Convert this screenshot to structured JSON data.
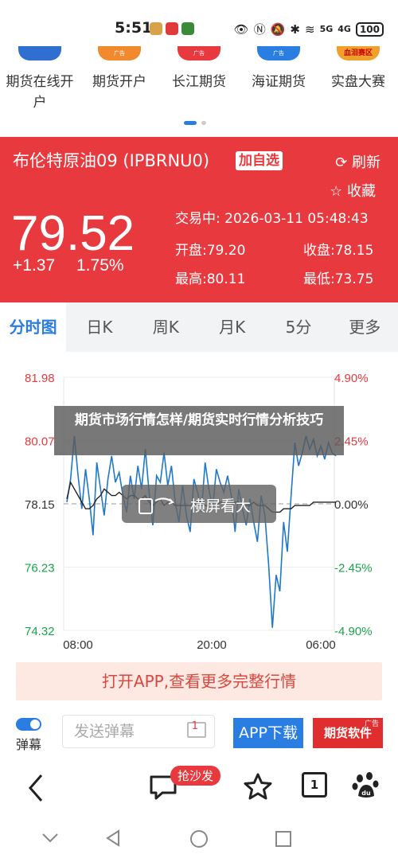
{
  "status_bar": {
    "time": "5:51",
    "network": "5G",
    "network2": "4G",
    "battery": "100"
  },
  "shortcuts": [
    {
      "label": "期货在线开户",
      "color": "#2e6fcf"
    },
    {
      "label": "期货开户",
      "color": "#f08a2c",
      "tag": "广告"
    },
    {
      "label": "长江期货",
      "color": "#e8393e",
      "tag": "广告"
    },
    {
      "label": "海证期货",
      "color": "#2a7de1",
      "tag": "广告"
    },
    {
      "label": "实盘大赛",
      "color": "#f0a12c",
      "tag": "血泪赛区"
    }
  ],
  "quote": {
    "name": "布伦特原油09 (IPBRNU0)",
    "watch_label": "加自选",
    "refresh_label": "刷新",
    "fav_label": "收藏",
    "price": "79.52",
    "change": "+1.37",
    "change_pct": "1.75%",
    "trade_status": "交易中: 2026-03-11 05:48:43",
    "open": "开盘:79.20",
    "prev_close": "收盘:78.15",
    "high": "最高:80.11",
    "low": "最低:73.75"
  },
  "tabs": [
    "分时图",
    "日K",
    "周K",
    "月K",
    "5分",
    "更多"
  ],
  "chart_data": {
    "type": "line",
    "title": "",
    "xlabel": "",
    "ylabel": "",
    "x_ticks": [
      "08:00",
      "20:00",
      "06:00"
    ],
    "y_ticks_left": [
      "81.98",
      "80.07",
      "78.15",
      "76.23",
      "74.32"
    ],
    "y_ticks_right": [
      "4.90%",
      "2.45%",
      "0.00%",
      "-2.45%",
      "-4.90%"
    ],
    "ylim": [
      74.32,
      81.98
    ],
    "reference_price": 78.15,
    "series": [
      {
        "color": "#1f78c8",
        "values": [
          78.2,
          78.9,
          80.2,
          79.0,
          78.0,
          79.2,
          78.3,
          77.2,
          79.4,
          78.6,
          77.8,
          78.9,
          79.6,
          78.8,
          79.1,
          78.4,
          77.9,
          79.0,
          78.3,
          79.3,
          78.6,
          79.8,
          78.5,
          77.5,
          79.0,
          78.8,
          79.7,
          78.7,
          79.3,
          78.2,
          77.6,
          78.7,
          77.8,
          77.3,
          78.9,
          78.5,
          77.9,
          79.4,
          78.6,
          78.0,
          79.2,
          78.8,
          78.5,
          79.0,
          78.4,
          77.3,
          78.6,
          78.0,
          77.5,
          78.3,
          77.6,
          77.0,
          78.4,
          77.8,
          76.3,
          74.4,
          76.0,
          75.5,
          77.6,
          76.7,
          78.4,
          80.0,
          79.3,
          79.7,
          80.2,
          79.8,
          80.1,
          79.6,
          79.9,
          79.5,
          80.0,
          79.7,
          79.6
        ]
      },
      {
        "color": "#222222",
        "values": [
          78.3,
          78.8,
          78.6,
          78.4,
          78.2,
          78.0,
          78.0,
          78.1,
          78.3,
          78.4,
          78.6,
          78.5,
          78.4,
          78.4,
          78.5,
          78.4,
          78.3,
          78.4,
          78.4,
          78.3,
          78.3,
          78.4,
          78.2,
          78.1,
          78.2,
          78.3,
          78.1,
          78.2,
          78.2,
          78.1,
          78.1,
          78.1,
          78.1,
          78.1,
          78.1,
          78.2,
          78.2,
          78.1,
          78.1,
          78.1,
          78.1,
          78.2,
          78.2,
          78.2,
          78.2,
          78.2,
          78.2,
          78.1,
          78.1,
          78.1,
          78.2,
          78.1,
          78.1,
          78.1,
          78.0,
          77.9,
          77.9,
          77.9,
          78.0,
          78.0,
          78.0,
          78.1,
          78.1,
          78.1,
          78.1,
          78.1,
          78.2,
          78.2,
          78.2,
          78.2,
          78.2,
          78.2,
          78.2
        ]
      }
    ]
  },
  "overlay_title": "期货市场行情怎样/期货实时行情分析技巧",
  "landscape_label": "横屏看大",
  "open_app": "打开APP,查看更多完整行情",
  "danmaku": {
    "toggle_label": "弹幕",
    "placeholder": "发送弹幕",
    "count": "1",
    "app_download": "APP下载",
    "ad_button": "期货软件",
    "ad_tag": "广告"
  },
  "toolbar": {
    "sofa_label": "抢沙发",
    "tabs_count": "1"
  }
}
